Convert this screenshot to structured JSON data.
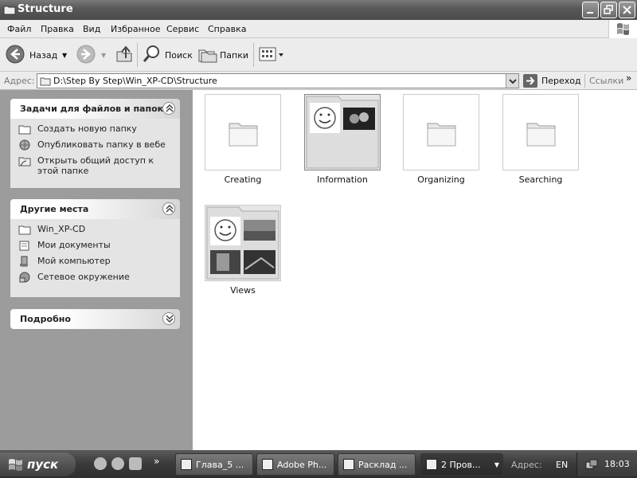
{
  "window": {
    "title": "Structure"
  },
  "menu": [
    "Файл",
    "Правка",
    "Вид",
    "Избранное",
    "Сервис",
    "Справка"
  ],
  "toolbar": {
    "back": "Назад",
    "search": "Поиск",
    "folders": "Папки"
  },
  "address": {
    "label": "Адрес:",
    "path": "D:\\Step By Step\\Win_XP-CD\\Structure",
    "go": "Переход",
    "links": "Ссылки",
    "chevron": "»"
  },
  "left": {
    "tasks": {
      "title": "Задачи для файлов и папок",
      "items": [
        "Создать новую папку",
        "Опубликовать папку в вебе",
        "Открыть общий доступ к этой папке"
      ]
    },
    "places": {
      "title": "Другие места",
      "items": [
        "Win_XP-CD",
        "Мои документы",
        "Мой компьютер",
        "Сетевое окружение"
      ]
    },
    "details": {
      "title": "Подробно"
    }
  },
  "folders": [
    {
      "name": "Creating",
      "type": "folder"
    },
    {
      "name": "Information",
      "type": "thumbs"
    },
    {
      "name": "Organizing",
      "type": "folder"
    },
    {
      "name": "Searching",
      "type": "folder"
    },
    {
      "name": "Views",
      "type": "thumbs4"
    }
  ],
  "taskbar": {
    "start": "пуск",
    "chevron": "»",
    "buttons": [
      "Глава_5 ...",
      "Adobe Ph...",
      "Расклад ...",
      "2 Пров..."
    ],
    "address": "Адрес:",
    "lang": "EN",
    "clock": "18:03"
  }
}
